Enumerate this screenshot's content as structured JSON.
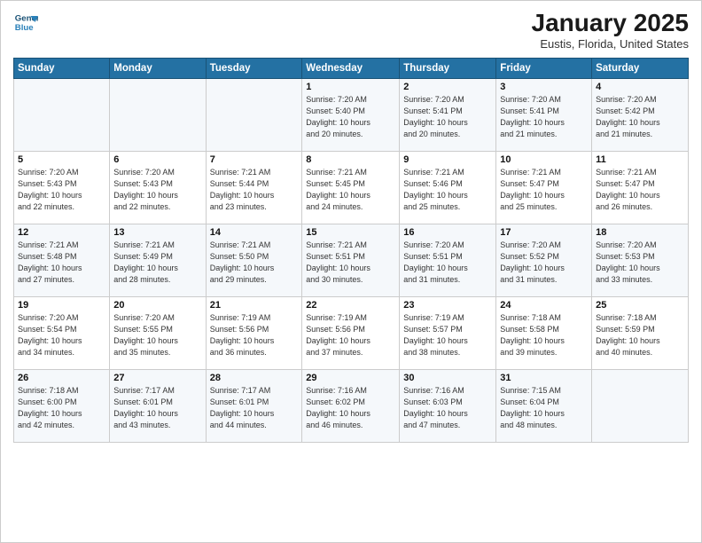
{
  "logo": {
    "line1": "General",
    "line2": "Blue"
  },
  "title": "January 2025",
  "subtitle": "Eustis, Florida, United States",
  "days_header": [
    "Sunday",
    "Monday",
    "Tuesday",
    "Wednesday",
    "Thursday",
    "Friday",
    "Saturday"
  ],
  "weeks": [
    [
      {
        "day": "",
        "info": ""
      },
      {
        "day": "",
        "info": ""
      },
      {
        "day": "",
        "info": ""
      },
      {
        "day": "1",
        "info": "Sunrise: 7:20 AM\nSunset: 5:40 PM\nDaylight: 10 hours\nand 20 minutes."
      },
      {
        "day": "2",
        "info": "Sunrise: 7:20 AM\nSunset: 5:41 PM\nDaylight: 10 hours\nand 20 minutes."
      },
      {
        "day": "3",
        "info": "Sunrise: 7:20 AM\nSunset: 5:41 PM\nDaylight: 10 hours\nand 21 minutes."
      },
      {
        "day": "4",
        "info": "Sunrise: 7:20 AM\nSunset: 5:42 PM\nDaylight: 10 hours\nand 21 minutes."
      }
    ],
    [
      {
        "day": "5",
        "info": "Sunrise: 7:20 AM\nSunset: 5:43 PM\nDaylight: 10 hours\nand 22 minutes."
      },
      {
        "day": "6",
        "info": "Sunrise: 7:20 AM\nSunset: 5:43 PM\nDaylight: 10 hours\nand 22 minutes."
      },
      {
        "day": "7",
        "info": "Sunrise: 7:21 AM\nSunset: 5:44 PM\nDaylight: 10 hours\nand 23 minutes."
      },
      {
        "day": "8",
        "info": "Sunrise: 7:21 AM\nSunset: 5:45 PM\nDaylight: 10 hours\nand 24 minutes."
      },
      {
        "day": "9",
        "info": "Sunrise: 7:21 AM\nSunset: 5:46 PM\nDaylight: 10 hours\nand 25 minutes."
      },
      {
        "day": "10",
        "info": "Sunrise: 7:21 AM\nSunset: 5:47 PM\nDaylight: 10 hours\nand 25 minutes."
      },
      {
        "day": "11",
        "info": "Sunrise: 7:21 AM\nSunset: 5:47 PM\nDaylight: 10 hours\nand 26 minutes."
      }
    ],
    [
      {
        "day": "12",
        "info": "Sunrise: 7:21 AM\nSunset: 5:48 PM\nDaylight: 10 hours\nand 27 minutes."
      },
      {
        "day": "13",
        "info": "Sunrise: 7:21 AM\nSunset: 5:49 PM\nDaylight: 10 hours\nand 28 minutes."
      },
      {
        "day": "14",
        "info": "Sunrise: 7:21 AM\nSunset: 5:50 PM\nDaylight: 10 hours\nand 29 minutes."
      },
      {
        "day": "15",
        "info": "Sunrise: 7:21 AM\nSunset: 5:51 PM\nDaylight: 10 hours\nand 30 minutes."
      },
      {
        "day": "16",
        "info": "Sunrise: 7:20 AM\nSunset: 5:51 PM\nDaylight: 10 hours\nand 31 minutes."
      },
      {
        "day": "17",
        "info": "Sunrise: 7:20 AM\nSunset: 5:52 PM\nDaylight: 10 hours\nand 31 minutes."
      },
      {
        "day": "18",
        "info": "Sunrise: 7:20 AM\nSunset: 5:53 PM\nDaylight: 10 hours\nand 33 minutes."
      }
    ],
    [
      {
        "day": "19",
        "info": "Sunrise: 7:20 AM\nSunset: 5:54 PM\nDaylight: 10 hours\nand 34 minutes."
      },
      {
        "day": "20",
        "info": "Sunrise: 7:20 AM\nSunset: 5:55 PM\nDaylight: 10 hours\nand 35 minutes."
      },
      {
        "day": "21",
        "info": "Sunrise: 7:19 AM\nSunset: 5:56 PM\nDaylight: 10 hours\nand 36 minutes."
      },
      {
        "day": "22",
        "info": "Sunrise: 7:19 AM\nSunset: 5:56 PM\nDaylight: 10 hours\nand 37 minutes."
      },
      {
        "day": "23",
        "info": "Sunrise: 7:19 AM\nSunset: 5:57 PM\nDaylight: 10 hours\nand 38 minutes."
      },
      {
        "day": "24",
        "info": "Sunrise: 7:18 AM\nSunset: 5:58 PM\nDaylight: 10 hours\nand 39 minutes."
      },
      {
        "day": "25",
        "info": "Sunrise: 7:18 AM\nSunset: 5:59 PM\nDaylight: 10 hours\nand 40 minutes."
      }
    ],
    [
      {
        "day": "26",
        "info": "Sunrise: 7:18 AM\nSunset: 6:00 PM\nDaylight: 10 hours\nand 42 minutes."
      },
      {
        "day": "27",
        "info": "Sunrise: 7:17 AM\nSunset: 6:01 PM\nDaylight: 10 hours\nand 43 minutes."
      },
      {
        "day": "28",
        "info": "Sunrise: 7:17 AM\nSunset: 6:01 PM\nDaylight: 10 hours\nand 44 minutes."
      },
      {
        "day": "29",
        "info": "Sunrise: 7:16 AM\nSunset: 6:02 PM\nDaylight: 10 hours\nand 46 minutes."
      },
      {
        "day": "30",
        "info": "Sunrise: 7:16 AM\nSunset: 6:03 PM\nDaylight: 10 hours\nand 47 minutes."
      },
      {
        "day": "31",
        "info": "Sunrise: 7:15 AM\nSunset: 6:04 PM\nDaylight: 10 hours\nand 48 minutes."
      },
      {
        "day": "",
        "info": ""
      }
    ]
  ]
}
